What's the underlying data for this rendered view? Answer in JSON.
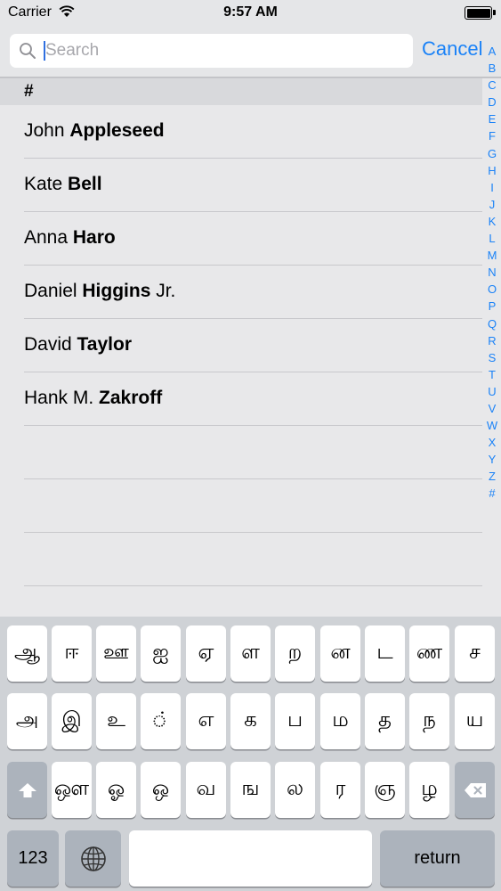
{
  "status_bar": {
    "carrier": "Carrier",
    "time": "9:57 AM"
  },
  "search": {
    "placeholder": "Search",
    "value": "",
    "cancel_label": "Cancel"
  },
  "section": {
    "title": "#"
  },
  "contacts": [
    {
      "first": "John ",
      "last": "Appleseed",
      "suffix": ""
    },
    {
      "first": "Kate ",
      "last": "Bell",
      "suffix": ""
    },
    {
      "first": "Anna ",
      "last": "Haro",
      "suffix": ""
    },
    {
      "first": "Daniel ",
      "last": "Higgins",
      "suffix": " Jr."
    },
    {
      "first": "David ",
      "last": "Taylor",
      "suffix": ""
    },
    {
      "first": "Hank M. ",
      "last": "Zakroff",
      "suffix": ""
    }
  ],
  "empty_rows": 3,
  "section_index": [
    "A",
    "B",
    "C",
    "D",
    "E",
    "F",
    "G",
    "H",
    "I",
    "J",
    "K",
    "L",
    "M",
    "N",
    "O",
    "P",
    "Q",
    "R",
    "S",
    "T",
    "U",
    "V",
    "W",
    "X",
    "Y",
    "Z",
    "#"
  ],
  "keyboard": {
    "row1": [
      "ஆ",
      "ஈ",
      "ஊ",
      "ஐ",
      "ஏ",
      "ள",
      "ற",
      "ன",
      "ட",
      "ண",
      "ச"
    ],
    "row2": [
      "அ",
      "இ",
      "உ",
      "்",
      "எ",
      "க",
      "ப",
      "ம",
      "த",
      "ந",
      "ய"
    ],
    "row3": [
      "ஔ",
      "ஓ",
      "ஒ",
      "வ",
      "ங",
      "ல",
      "ர",
      "ஞ",
      "ழ"
    ],
    "numbers_label": "123",
    "return_label": "return"
  },
  "colors": {
    "accent": "#1a82f7",
    "caret": "#2f6fe0"
  }
}
